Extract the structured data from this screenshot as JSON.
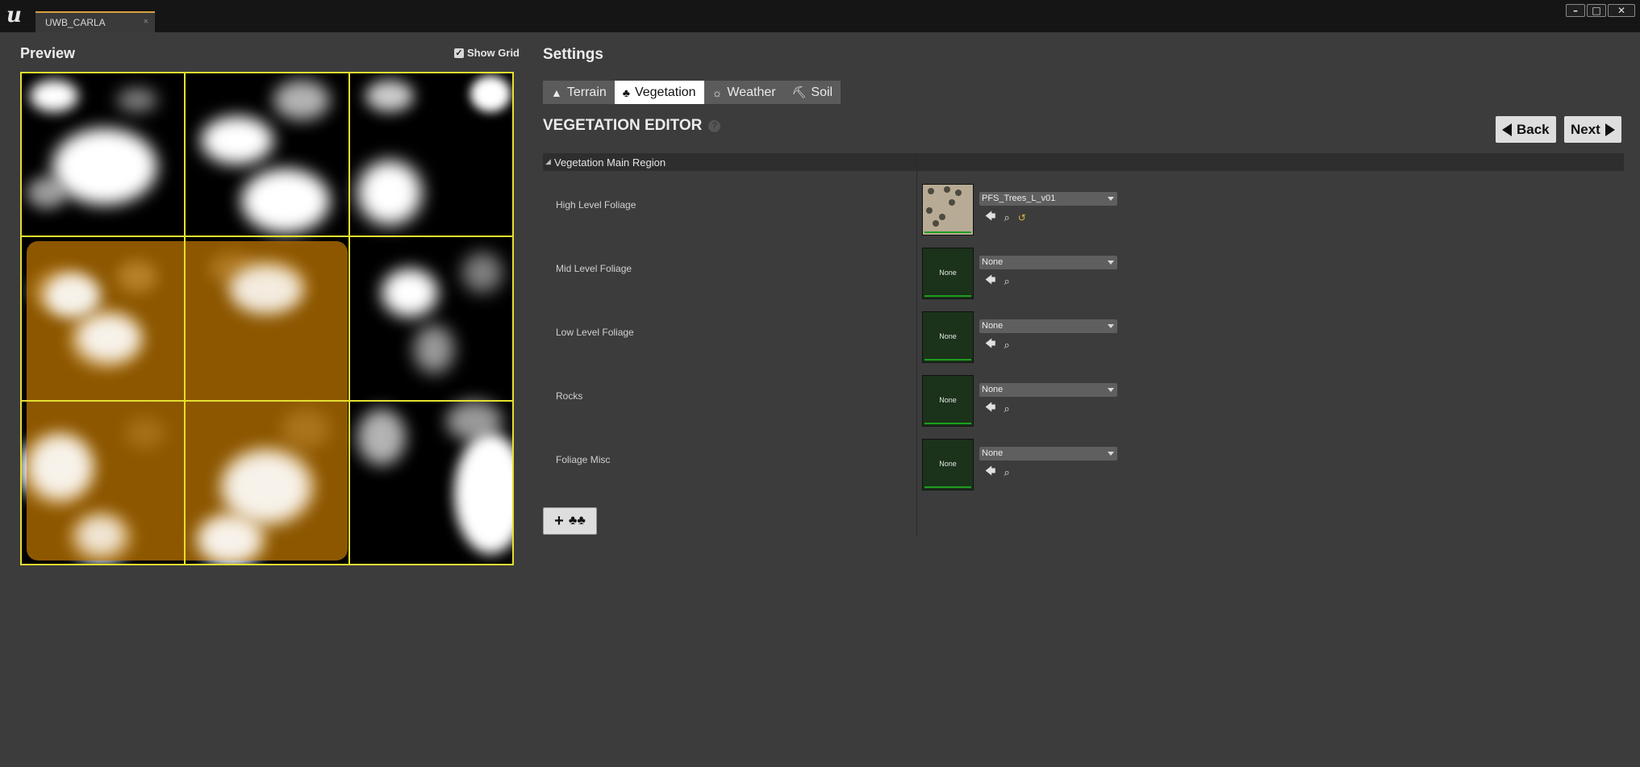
{
  "window": {
    "tab_label": "UWB_CARLA",
    "tab_close": "×",
    "controls": {
      "minimize": "–",
      "maximize": "□",
      "close": "✕"
    }
  },
  "preview": {
    "title": "Preview",
    "show_grid_label": "Show Grid",
    "show_grid_checked": true,
    "grid": {
      "rows": 3,
      "cols": 3
    },
    "selected_color": "#a86800",
    "grid_color": "#e4e030"
  },
  "settings": {
    "title": "Settings",
    "tabs": [
      {
        "label": "Terrain",
        "icon": "mountain-icon",
        "active": false
      },
      {
        "label": "Vegetation",
        "icon": "trees-icon",
        "active": true
      },
      {
        "label": "Weather",
        "icon": "weather-icon",
        "active": false
      },
      {
        "label": "Soil",
        "icon": "soil-icon",
        "active": false
      }
    ]
  },
  "editor": {
    "title": "VEGETATION EDITOR",
    "help_icon": "?",
    "back_label": "Back",
    "next_label": "Next",
    "region_title": "Vegetation Main Region",
    "properties": [
      {
        "label": "High Level Foliage",
        "value": "PFS_Trees_L_v01",
        "thumb": "",
        "has_reset": true
      },
      {
        "label": "Mid Level Foliage",
        "value": "None",
        "thumb": "None",
        "has_reset": false
      },
      {
        "label": "Low Level Foliage",
        "value": "None",
        "thumb": "None",
        "has_reset": false
      },
      {
        "label": "Rocks",
        "value": "None",
        "thumb": "None",
        "has_reset": false
      },
      {
        "label": "Foliage Misc",
        "value": "None",
        "thumb": "None",
        "has_reset": false
      }
    ],
    "add_button_icons": [
      "plus-icon",
      "trees-icon"
    ]
  }
}
